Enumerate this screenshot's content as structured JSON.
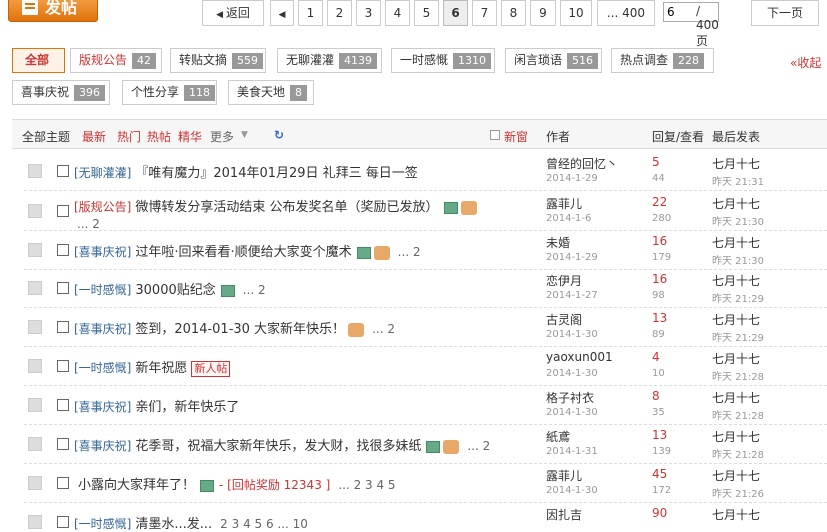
{
  "header": {
    "post_label": "发帖"
  },
  "pager": {
    "prev": "返回",
    "pages": [
      "1",
      "2",
      "3",
      "4",
      "5",
      "6",
      "7",
      "8",
      "9",
      "10"
    ],
    "current": "6",
    "ellipsis": "... 400",
    "input_value": "6",
    "total": "/ 400 页",
    "next": "下一页"
  },
  "filters": [
    {
      "label": "全部",
      "count": ""
    },
    {
      "label": "版规公告",
      "count": "42"
    },
    {
      "label": "转贴文摘",
      "count": "559"
    },
    {
      "label": "无聊灌灌",
      "count": "4139"
    },
    {
      "label": "一时感慨",
      "count": "1310"
    },
    {
      "label": "闲言琐语",
      "count": "516"
    },
    {
      "label": "热点调查",
      "count": "228"
    },
    {
      "label": "喜事庆祝",
      "count": "396"
    },
    {
      "label": "个性分享",
      "count": "118"
    },
    {
      "label": "美食天地",
      "count": "8"
    }
  ],
  "collapse_label": "«收起",
  "table_header": {
    "all": "全部主题",
    "latest": "最新",
    "hot": "热门",
    "hotposts": "热帖",
    "digest": "精华",
    "more": "更多",
    "new_window": "新窗",
    "author": "作者",
    "replies": "回复/查看",
    "last_post": "最后发表"
  },
  "rows": [
    {
      "cat": "[无聊灌灌]",
      "title": "『唯有魔力』2014年01月29日 礼拜三 每日一签",
      "img": false,
      "thumb": false,
      "pages": "",
      "newtag": "",
      "author": "曾经的回忆丶",
      "date": "2014-1-29",
      "replies": "5",
      "views": "44",
      "last": "七月十七",
      "ltime": "昨天 21:31"
    },
    {
      "cat": "[版规公告]",
      "title": "微博转发分享活动结束 公布发奖名单（奖励已发放）",
      "img": true,
      "thumb": true,
      "pages": "... 2",
      "newtag": "",
      "author": "露菲儿",
      "date": "2014-1-6",
      "replies": "22",
      "views": "280",
      "last": "七月十七",
      "ltime": "昨天 21:30"
    },
    {
      "cat": "[喜事庆祝]",
      "title": "过年啦·回来看看·顺便给大家变个魔术",
      "img": true,
      "thumb": true,
      "pages": "... 2",
      "newtag": "",
      "author": "未婚",
      "date": "2014-1-29",
      "replies": "16",
      "views": "179",
      "last": "七月十七",
      "ltime": "昨天 21:30"
    },
    {
      "cat": "[一时感慨]",
      "title": "30000贴纪念",
      "img": true,
      "thumb": false,
      "pages": "... 2",
      "newtag": "",
      "author": "恋伊月",
      "date": "2014-1-27",
      "replies": "16",
      "views": "98",
      "last": "七月十七",
      "ltime": "昨天 21:29"
    },
    {
      "cat": "[喜事庆祝]",
      "title": "签到，2014-01-30 大家新年快乐！",
      "img": false,
      "thumb": true,
      "pages": "... 2",
      "newtag": "",
      "author": "古灵阁",
      "date": "2014-1-30",
      "replies": "13",
      "views": "89",
      "last": "七月十七",
      "ltime": "昨天 21:29"
    },
    {
      "cat": "[一时感慨]",
      "title": "新年祝愿",
      "img": false,
      "thumb": false,
      "pages": "",
      "newtag": "新人帖",
      "author": "yaoxun001",
      "date": "2014-1-30",
      "replies": "4",
      "views": "10",
      "last": "七月十七",
      "ltime": "昨天 21:28"
    },
    {
      "cat": "[喜事庆祝]",
      "title": "亲们，新年快乐了",
      "img": false,
      "thumb": false,
      "pages": "",
      "newtag": "",
      "author": "格子衬衣",
      "date": "2014-1-30",
      "replies": "8",
      "views": "35",
      "last": "七月十七",
      "ltime": "昨天 21:28"
    },
    {
      "cat": "[喜事庆祝]",
      "title": "花季哥，祝福大家新年快乐，发大财，找很多妹纸",
      "img": true,
      "thumb": true,
      "pages": "... 2",
      "newtag": "",
      "author": "紙鳶",
      "date": "2014-1-31",
      "replies": "13",
      "views": "139",
      "last": "七月十七",
      "ltime": "昨天 21:28"
    },
    {
      "cat": "",
      "title": "小露向大家拜年了！",
      "img": true,
      "thumb": false,
      "pages": "... 2 3 4 5",
      "bonus": "- [回帖奖励 12343 ]",
      "newtag": "",
      "author": "露菲儿",
      "date": "2014-1-30",
      "replies": "45",
      "views": "172",
      "last": "七月十七",
      "ltime": "昨天 21:26"
    },
    {
      "cat": "[一时感慨]",
      "title": "清墨水...发...",
      "img": false,
      "thumb": false,
      "pages": "2 3 4 5 6 ... 10",
      "newtag": "",
      "author": "因扎吉",
      "date": "",
      "replies": "90",
      "views": "",
      "last": "七月十七",
      "ltime": ""
    }
  ]
}
